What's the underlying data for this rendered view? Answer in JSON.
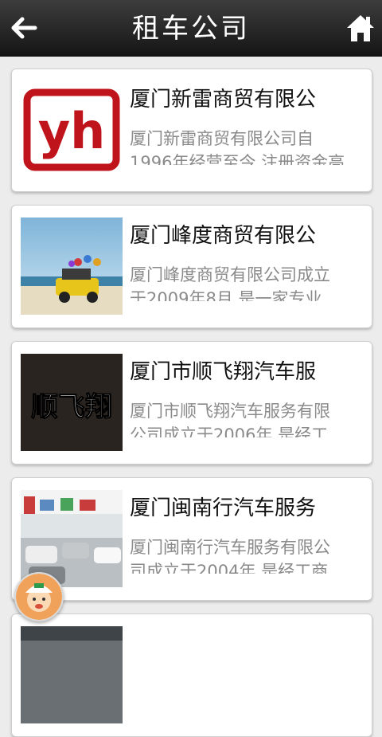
{
  "header": {
    "title": "租车公司",
    "back_icon": "arrow-left-icon",
    "home_icon": "home-icon"
  },
  "companies": [
    {
      "name": "厦门新雷商贸有限公",
      "desc_line1": "厦门新雷商贸有限公司自",
      "desc_line2": "1996年经营至今,注册资金高",
      "logo_text": "yh"
    },
    {
      "name": "厦门峰度商贸有限公",
      "desc_line1": "厦门峰度商贸有限公司成立",
      "desc_line2": "于2009年8月,是一家专业"
    },
    {
      "name": "厦门市顺飞翔汽车服",
      "desc_line1": "厦门市顺飞翔汽车服务有限",
      "desc_line2": "公司成立于2006年,是经工",
      "logo_text": "顺飞翔"
    },
    {
      "name": "厦门闽南行汽车服务",
      "desc_line1": "厦门闽南行汽车服务有限公",
      "desc_line2": "司成立于2004年,是经工商"
    }
  ],
  "colors": {
    "header": "#1e1e1e",
    "background": "#ececec",
    "title_text": "#111111",
    "desc_text": "#8a8a8a",
    "logo_red": "#c0141c"
  },
  "floating_button_icon": "assistant-avatar-icon"
}
